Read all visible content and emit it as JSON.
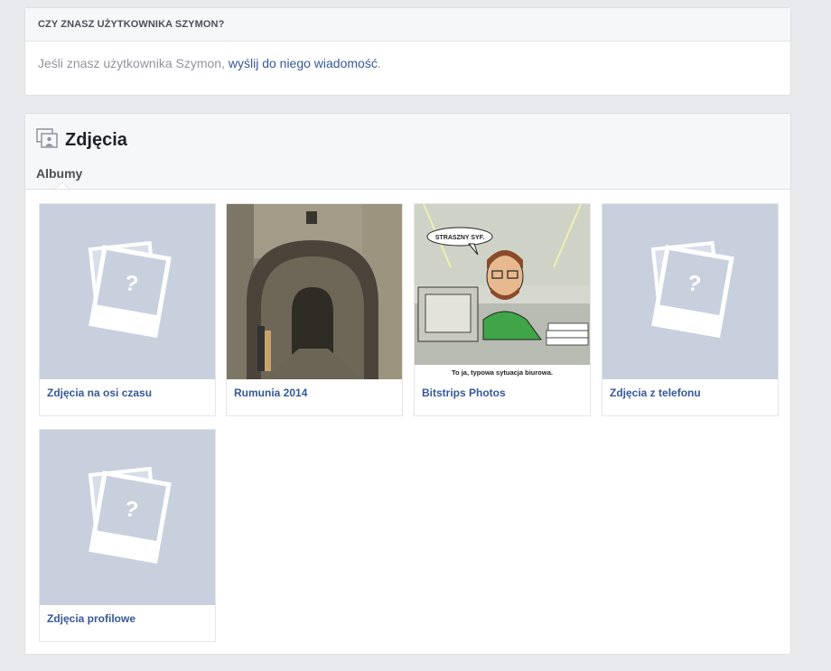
{
  "know": {
    "heading": "CZY ZNASZ UŻYTKOWNIKA SZYMON?",
    "text_prefix": "Jeśli znasz użytkownika Szymon, ",
    "link": "wyślij do niego wiadomość",
    "text_suffix": "."
  },
  "photos": {
    "title": "Zdjęcia",
    "tab": "Albumy",
    "albums": [
      {
        "name": "Zdjęcia na osi czasu",
        "kind": "placeholder"
      },
      {
        "name": "Rumunia 2014",
        "kind": "photo-archway"
      },
      {
        "name": "Bitstrips Photos",
        "kind": "comic"
      },
      {
        "name": "Zdjęcia z telefonu",
        "kind": "placeholder"
      },
      {
        "name": "Zdjęcia profilowe",
        "kind": "placeholder"
      }
    ],
    "comic": {
      "bubble": "STRASZNY SYF.",
      "caption": "To ja, typowa sytuacja biurowa."
    }
  },
  "colors": {
    "background": "#e9eaed",
    "link": "#365899",
    "placeholder": "#c8d0de"
  }
}
